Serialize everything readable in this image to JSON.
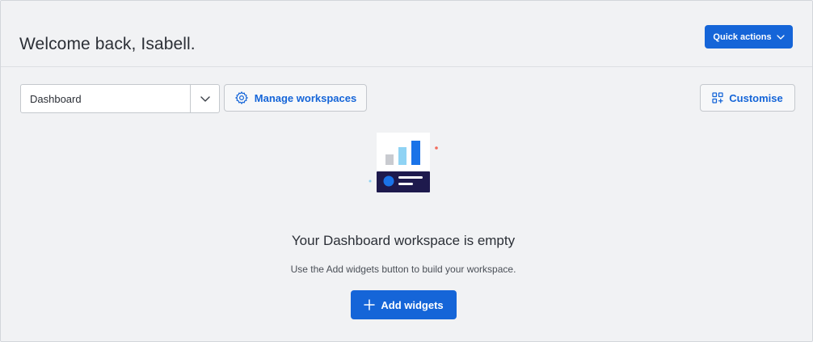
{
  "header": {
    "welcome_text": "Welcome back, Isabell.",
    "quick_actions_label": "Quick actions"
  },
  "toolbar": {
    "workspace_select_value": "Dashboard",
    "manage_workspaces_label": "Manage workspaces",
    "customise_label": "Customise"
  },
  "empty_state": {
    "title": "Your Dashboard workspace is empty",
    "subtitle": "Use the Add widgets button to build your workspace.",
    "add_widgets_label": "Add widgets"
  },
  "icons": {
    "quick_actions_chevron": "chevron-down-icon",
    "select_chevron": "chevron-down-icon",
    "manage": "gear-icon",
    "customise": "grid-add-icon",
    "add": "plus-icon",
    "illustration": "dashboard-chart-illustration"
  },
  "colors": {
    "primary": "#1565d8",
    "background": "#f1f2f4",
    "text": "#2b2f36"
  }
}
